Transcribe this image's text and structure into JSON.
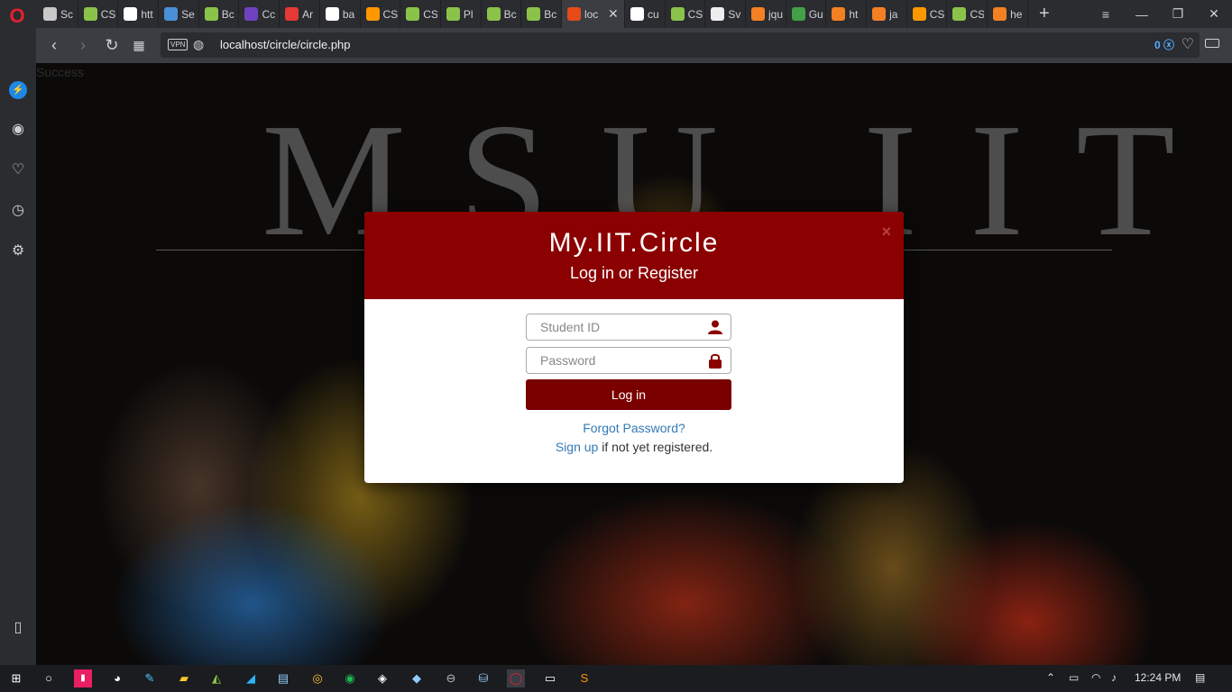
{
  "browser": {
    "tabs": [
      {
        "label": "Sc",
        "icon": "grid-icon",
        "color": "#c9c9c9",
        "text_color": "#333"
      },
      {
        "label": "CS",
        "icon": "code-icon",
        "color": "#8bc34a",
        "text_color": "#fff"
      },
      {
        "label": "htt",
        "icon": "google-icon",
        "color": "#ffffff",
        "text_color": "#4285f4"
      },
      {
        "label": "Se",
        "icon": "code-icon",
        "color": "#4a90d9",
        "text_color": "#fff"
      },
      {
        "label": "Bc",
        "icon": "code-icon",
        "color": "#8bc34a",
        "text_color": "#fff"
      },
      {
        "label": "Cc",
        "icon": "bootstrap-icon",
        "color": "#6f42c1",
        "text_color": "#fff"
      },
      {
        "label": "Ar",
        "icon": "f-icon",
        "color": "#e53935",
        "text_color": "#fff"
      },
      {
        "label": "ba",
        "icon": "google-icon",
        "color": "#ffffff",
        "text_color": "#4285f4"
      },
      {
        "label": "CS",
        "icon": "star-icon",
        "color": "#ff9800",
        "text_color": "#fff"
      },
      {
        "label": "CS",
        "icon": "code-icon",
        "color": "#8bc34a",
        "text_color": "#fff"
      },
      {
        "label": "Pl",
        "icon": "code-icon",
        "color": "#8bc34a",
        "text_color": "#fff"
      },
      {
        "label": "Bc",
        "icon": "code-icon",
        "color": "#8bc34a",
        "text_color": "#fff"
      },
      {
        "label": "Bc",
        "icon": "code-icon",
        "color": "#8bc34a",
        "text_color": "#fff"
      },
      {
        "label": "loc",
        "icon": "circle-icon",
        "color": "#e64a19",
        "text_color": "#fff",
        "active": true
      },
      {
        "label": "cu",
        "icon": "google-icon",
        "color": "#ffffff",
        "text_color": "#4285f4"
      },
      {
        "label": "CS",
        "icon": "code-icon",
        "color": "#8bc34a",
        "text_color": "#fff"
      },
      {
        "label": "Sv",
        "icon": "doc-icon",
        "color": "#eeeeee",
        "text_color": "#333"
      },
      {
        "label": "jqu",
        "icon": "stack-icon",
        "color": "#f48024",
        "text_color": "#fff"
      },
      {
        "label": "Gu",
        "icon": "cg-icon",
        "color": "#43a047",
        "text_color": "#fff"
      },
      {
        "label": "ht",
        "icon": "stack-icon",
        "color": "#f48024",
        "text_color": "#fff"
      },
      {
        "label": "ja",
        "icon": "stack-icon",
        "color": "#f48024",
        "text_color": "#fff"
      },
      {
        "label": "CS",
        "icon": "star-icon",
        "color": "#ff9800",
        "text_color": "#fff"
      },
      {
        "label": "CS",
        "icon": "code-icon",
        "color": "#8bc34a",
        "text_color": "#fff"
      },
      {
        "label": "he",
        "icon": "stack-icon",
        "color": "#f48024",
        "text_color": "#fff"
      }
    ],
    "vpn_label": "VPN",
    "url": "localhost/circle/circle.php",
    "adblock_count": "0"
  },
  "page": {
    "status_text": "Success",
    "watermark": "MSU IIT"
  },
  "modal": {
    "title": "My.IIT.Circle",
    "subtitle": "Log in or Register",
    "close_symbol": "×",
    "student_id_placeholder": "Student ID",
    "password_placeholder": "Password",
    "login_label": "Log in",
    "forgot_label": "Forgot Password?",
    "signup_link": "Sign up",
    "signup_suffix": " if not yet registered.",
    "accent_color": "#8b0000"
  },
  "taskbar": {
    "clock": "12:24 PM"
  }
}
